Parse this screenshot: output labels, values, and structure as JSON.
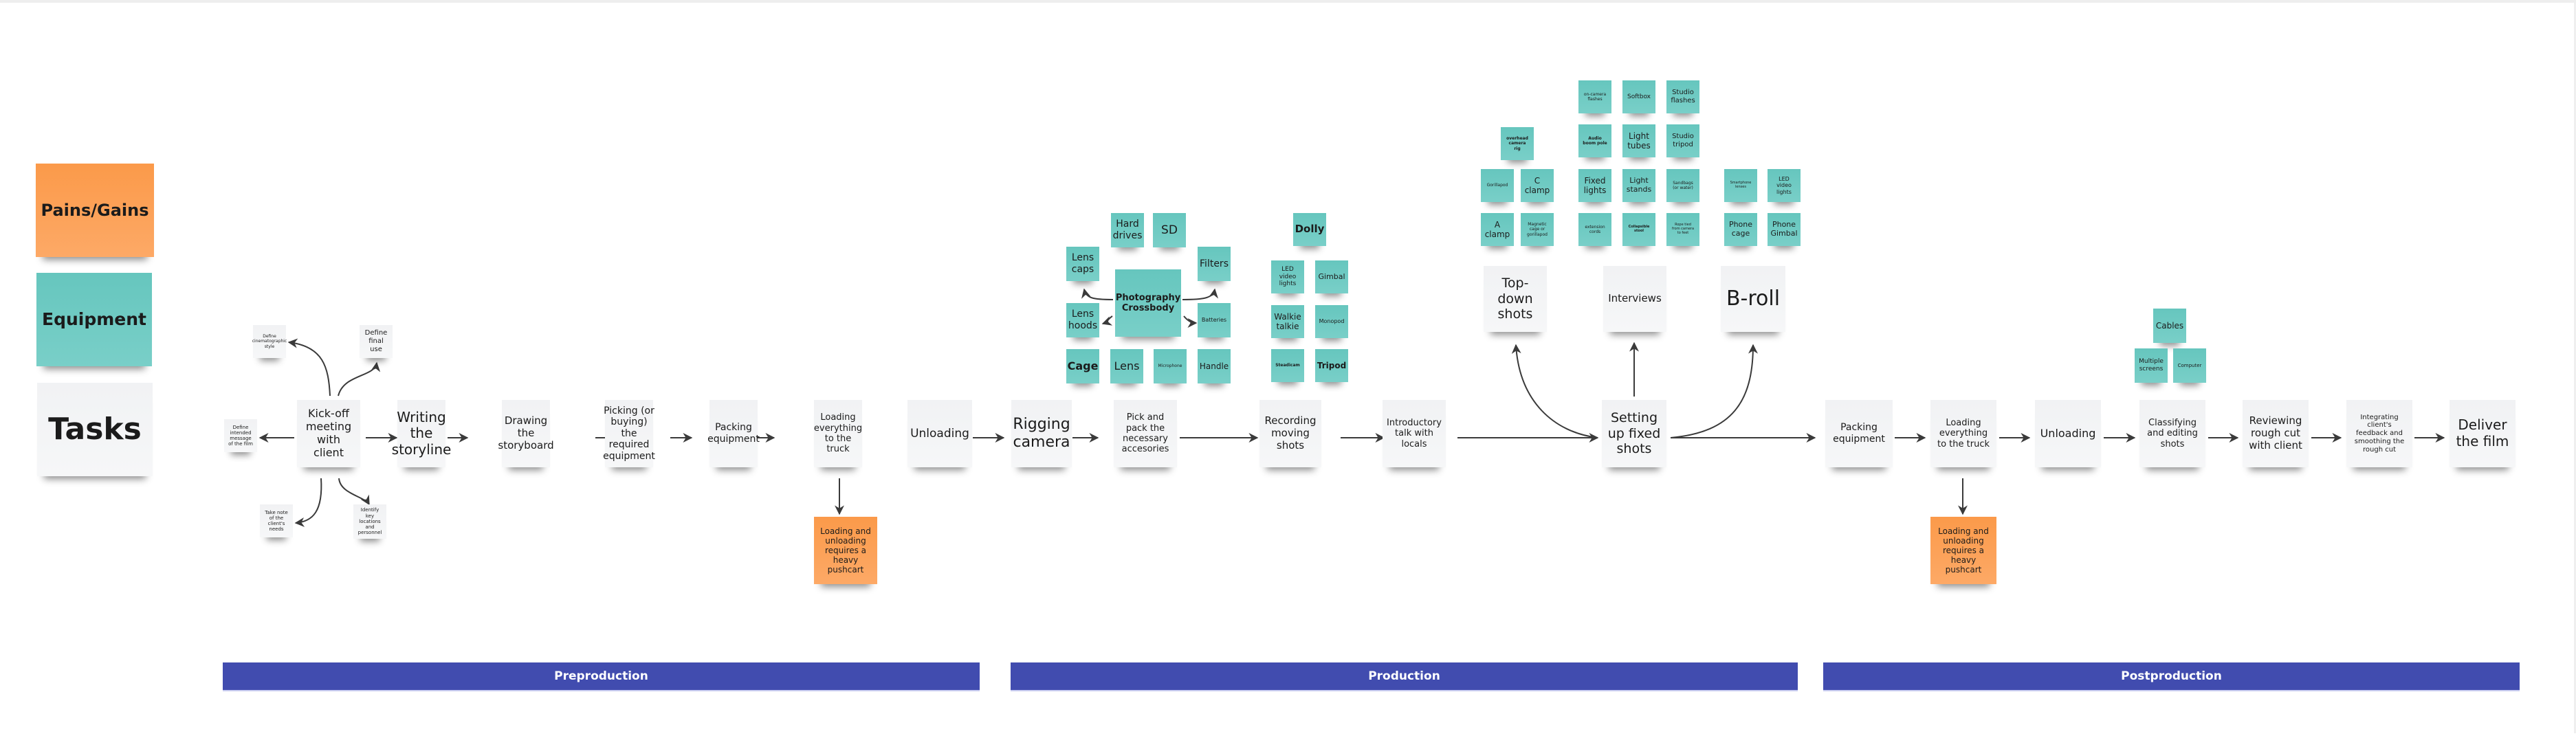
{
  "legend": {
    "pains_gains": "Pains/Gains",
    "equipment": "Equipment",
    "tasks": "Tasks"
  },
  "colors": {
    "task": "#f3f4f6",
    "equipment": "#6ccac2",
    "pain": "#fc9f55",
    "phase_bar": "#414caf",
    "connector": "#3a3a3a"
  },
  "phases": [
    {
      "label": "Preproduction"
    },
    {
      "label": "Production"
    },
    {
      "label": "Postproduction"
    }
  ],
  "preproduction": {
    "kickoff": "Kick-off meeting with client",
    "kickoff_branches": {
      "cinematographic_style": "Define cinematographic style",
      "final_use": "Define final use",
      "intended_message": "Define intended message of the film",
      "client_needs": "Take note of the client's needs",
      "key_locations": "Identify key locations and personnel"
    },
    "tasks": [
      "Writing the storyline",
      "Drawing the storyboard",
      "Picking (or buying) the required equipment",
      "Packing equipment",
      "Loading everything to the truck",
      "Unloading"
    ],
    "pain": "Loading and unloading requires a heavy pushcart"
  },
  "production": {
    "tasks": [
      "Rigging camera",
      "Pick and pack the necessary accesories",
      "Recording moving shots",
      "Introductory talk with locals",
      "Setting up fixed shots"
    ],
    "fixed_shot_types": [
      "Top-down shots",
      "Interviews",
      "B-roll"
    ],
    "rigging_equipment": {
      "center": "Photography Crossbody",
      "around": [
        "Hard drives",
        "SD",
        "Lens caps",
        "Filters",
        "Lens hoods",
        "Batteries"
      ],
      "bottom": [
        "Cage",
        "Lens",
        "Microphone",
        "Handle"
      ]
    },
    "moving_shot_equipment": [
      "Dolly",
      "LED video lights",
      "Gimbal",
      "Walkie talkie",
      "Monopod",
      "Steadicam",
      "Tripod"
    ],
    "topdown_equipment": [
      "overhead camera rig",
      "Gorillapod",
      "C clamp",
      "A clamp",
      "Magnetic cage or gorillapod"
    ],
    "interview_equipment": [
      "on-camera flashes",
      "Softbox",
      "Studio flashes",
      "Audio boom pole",
      "Light tubes",
      "Studio tripod",
      "Fixed lights",
      "Light stands",
      "Sandbags (or water)",
      "extension cords",
      "Collapsible stool",
      "Rope tied from camera to feet"
    ],
    "broll_equipment": [
      "Smartphone lenses",
      "LED video lights",
      "Phone cage",
      "Phone Gimbal"
    ]
  },
  "postproduction": {
    "tasks": [
      "Packing equipment",
      "Loading everything to the truck",
      "Unloading",
      "Classifying and editing shots",
      "Reviewing rough cut with client",
      "Integrating client's feedback and smoothing the rough cut",
      "Deliver the film"
    ],
    "pain": "Loading and unloading requires a heavy pushcart",
    "editing_equipment": [
      "Cables",
      "Multiple screens",
      "Computer"
    ]
  }
}
